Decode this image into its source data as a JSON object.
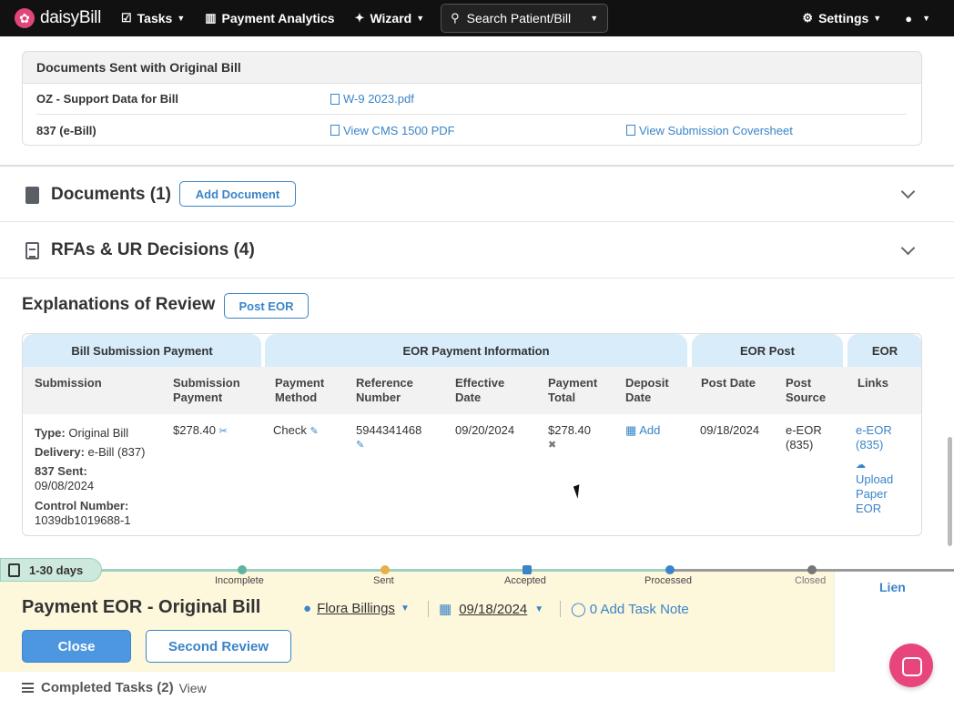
{
  "nav": {
    "brand": "daisyBill",
    "tasks": "Tasks",
    "analytics": "Payment Analytics",
    "wizard": "Wizard",
    "search": "Search Patient/Bill",
    "settings": "Settings"
  },
  "docs_sent": {
    "title": "Documents Sent with Original Bill",
    "rows": [
      {
        "label": "OZ - Support Data for Bill",
        "link": "W-9 2023.pdf"
      },
      {
        "label": "837 (e-Bill)",
        "link": "View CMS 1500 PDF",
        "link2": "View Submission Coversheet"
      }
    ]
  },
  "documents": {
    "title": "Documents (1)",
    "button": "Add Document"
  },
  "rfas": {
    "title": "RFAs & UR Decisions (4)"
  },
  "eor": {
    "title": "Explanations of Review",
    "post_button": "Post EOR",
    "groups": [
      "Bill Submission Payment",
      "EOR Payment Information",
      "EOR Post",
      "EOR"
    ],
    "headers": {
      "submission": "Submission",
      "submission_payment": "Submission Payment",
      "payment_method": "Payment Method",
      "reference_number": "Reference Number",
      "effective_date": "Effective Date",
      "payment_total": "Payment Total",
      "deposit_date": "Deposit Date",
      "post_date": "Post Date",
      "post_source": "Post Source",
      "links": "Links"
    },
    "row": {
      "type_label": "Type:",
      "type": "Original Bill",
      "delivery_label": "Delivery:",
      "delivery": "e-Bill (837)",
      "sent_label": "837 Sent:",
      "sent": "09/08/2024",
      "control_label": "Control Number:",
      "control": "1039db1019688-1",
      "submission_payment": "$278.40",
      "payment_method": "Check",
      "reference_number": "5944341468",
      "effective_date": "09/20/2024",
      "payment_total": "$278.40",
      "deposit_add": "Add",
      "post_date": "09/18/2024",
      "post_source": "e-EOR (835)",
      "link_eeor": "e-EOR (835)",
      "link_upload": "Upload Paper EOR"
    }
  },
  "task": {
    "days": "1-30 days",
    "milestones": [
      "Incomplete",
      "Sent",
      "Accepted",
      "Processed",
      "Closed"
    ],
    "lien": "Lien",
    "title": "Payment EOR - Original Bill",
    "assignee": "Flora Billings",
    "date": "09/18/2024",
    "note": "0 Add Task Note",
    "close_button": "Close",
    "second_review_button": "Second Review"
  },
  "completed": {
    "label": "Completed Tasks (2)",
    "view": "View"
  },
  "colors": {
    "accent": "#3a84c8",
    "brand": "#e0457b",
    "task_bg": "#fdf7dc",
    "group_bg": "#d8ecf9"
  }
}
